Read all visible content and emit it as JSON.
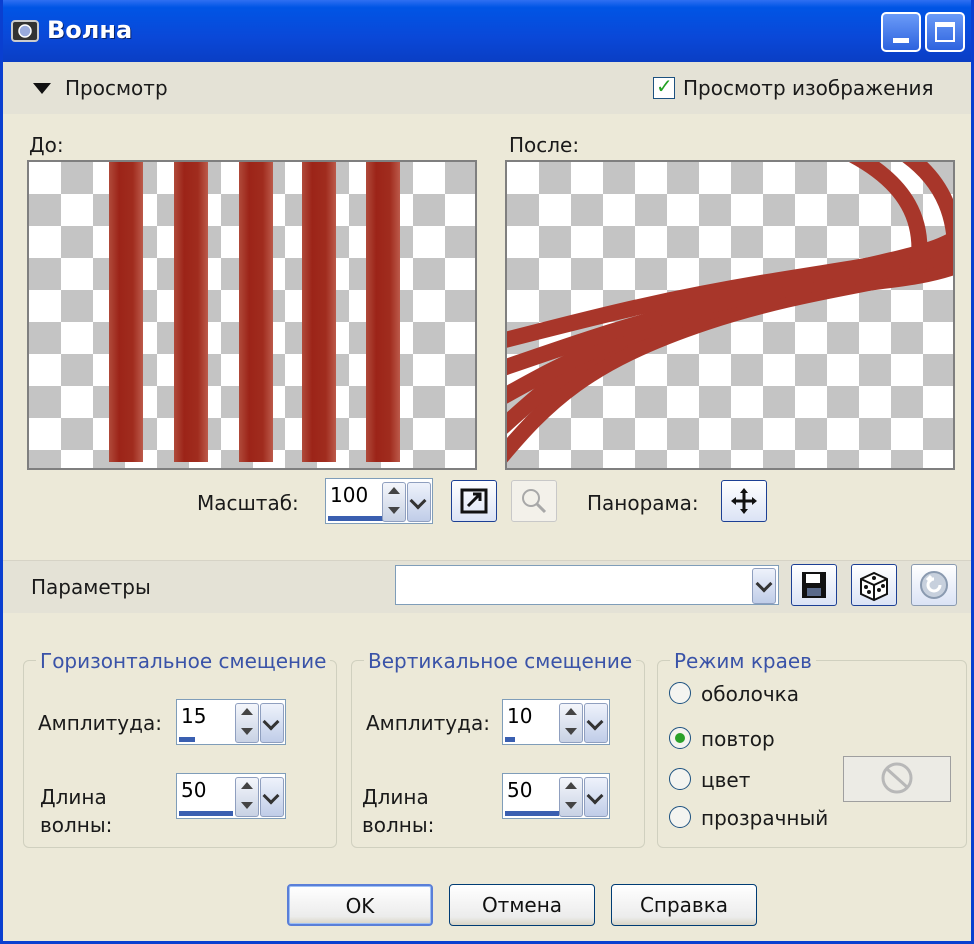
{
  "window": {
    "title": "Волна"
  },
  "preview": {
    "section_label": "Просмотр",
    "show_image_label": "Просмотр изображения",
    "show_image_checked": true,
    "before_label": "До:",
    "after_label": "После:",
    "zoom_label": "Масштаб:",
    "zoom_value": "100",
    "pan_label": "Панорама:"
  },
  "params": {
    "section_label": "Параметры",
    "preset_value": ""
  },
  "horizontal": {
    "title": "Горизонтальное смещение",
    "amplitude_label": "Амплитуда:",
    "amplitude_value": "15",
    "wavelength_label": "Длина волны:",
    "wavelength_value": "50"
  },
  "vertical": {
    "title": "Вертикальное смещение",
    "amplitude_label": "Амплитуда:",
    "amplitude_value": "10",
    "wavelength_label": "Длина волны:",
    "wavelength_value": "50"
  },
  "edge_mode": {
    "title": "Режим краев",
    "options": [
      "оболочка",
      "повтор",
      "цвет",
      "прозрачный"
    ],
    "selected": "повтор"
  },
  "buttons": {
    "ok": "OK",
    "cancel": "Отмена",
    "help": "Справка"
  },
  "colors": {
    "stripe": "#a02c1e",
    "titlebar": "#0a48d8",
    "radio_selected": "#2aa12a"
  }
}
